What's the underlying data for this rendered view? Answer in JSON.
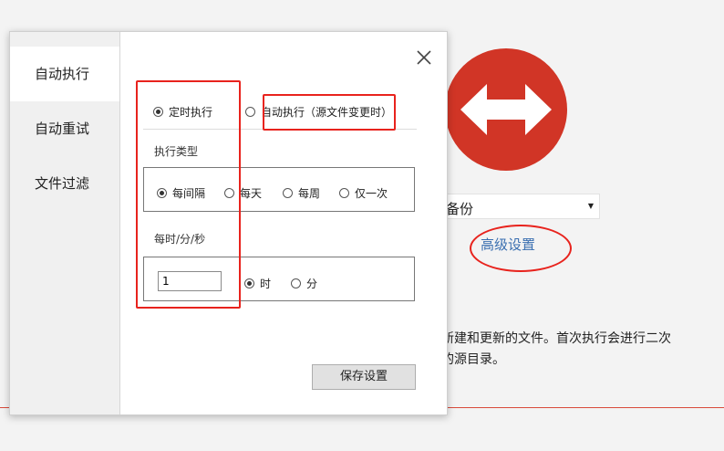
{
  "background": {
    "logo_icon": "double-arrow-icon",
    "logo_color": "#d13526",
    "select_value": "备份",
    "advanced_link": "高级设置",
    "description_line1": "中新建和更新的文件。首次执行会进行二次",
    "description_line2": "整的源目录。"
  },
  "sidebar": {
    "items": [
      {
        "label": "自动执行",
        "active": true
      },
      {
        "label": "自动重试",
        "active": false
      },
      {
        "label": "文件过滤",
        "active": false
      }
    ]
  },
  "dialog": {
    "close_icon": "close-icon",
    "mode": {
      "scheduled_label": "定时执行",
      "scheduled_selected": true,
      "on_change_label": "自动执行（源文件变更时）",
      "on_change_selected": false
    },
    "exec_type": {
      "title": "执行类型",
      "options": [
        {
          "label": "每间隔",
          "selected": true
        },
        {
          "label": "每天",
          "selected": false
        },
        {
          "label": "每周",
          "selected": false
        },
        {
          "label": "仅一次",
          "selected": false
        }
      ]
    },
    "interval": {
      "title": "每时/分/秒",
      "value": "1",
      "units": [
        {
          "label": "时",
          "selected": true
        },
        {
          "label": "分",
          "selected": false
        }
      ]
    },
    "save_label": "保存设置"
  },
  "colors": {
    "annotation": "#e8231d",
    "link": "#3a6fb0",
    "accent_red": "#d13526"
  }
}
